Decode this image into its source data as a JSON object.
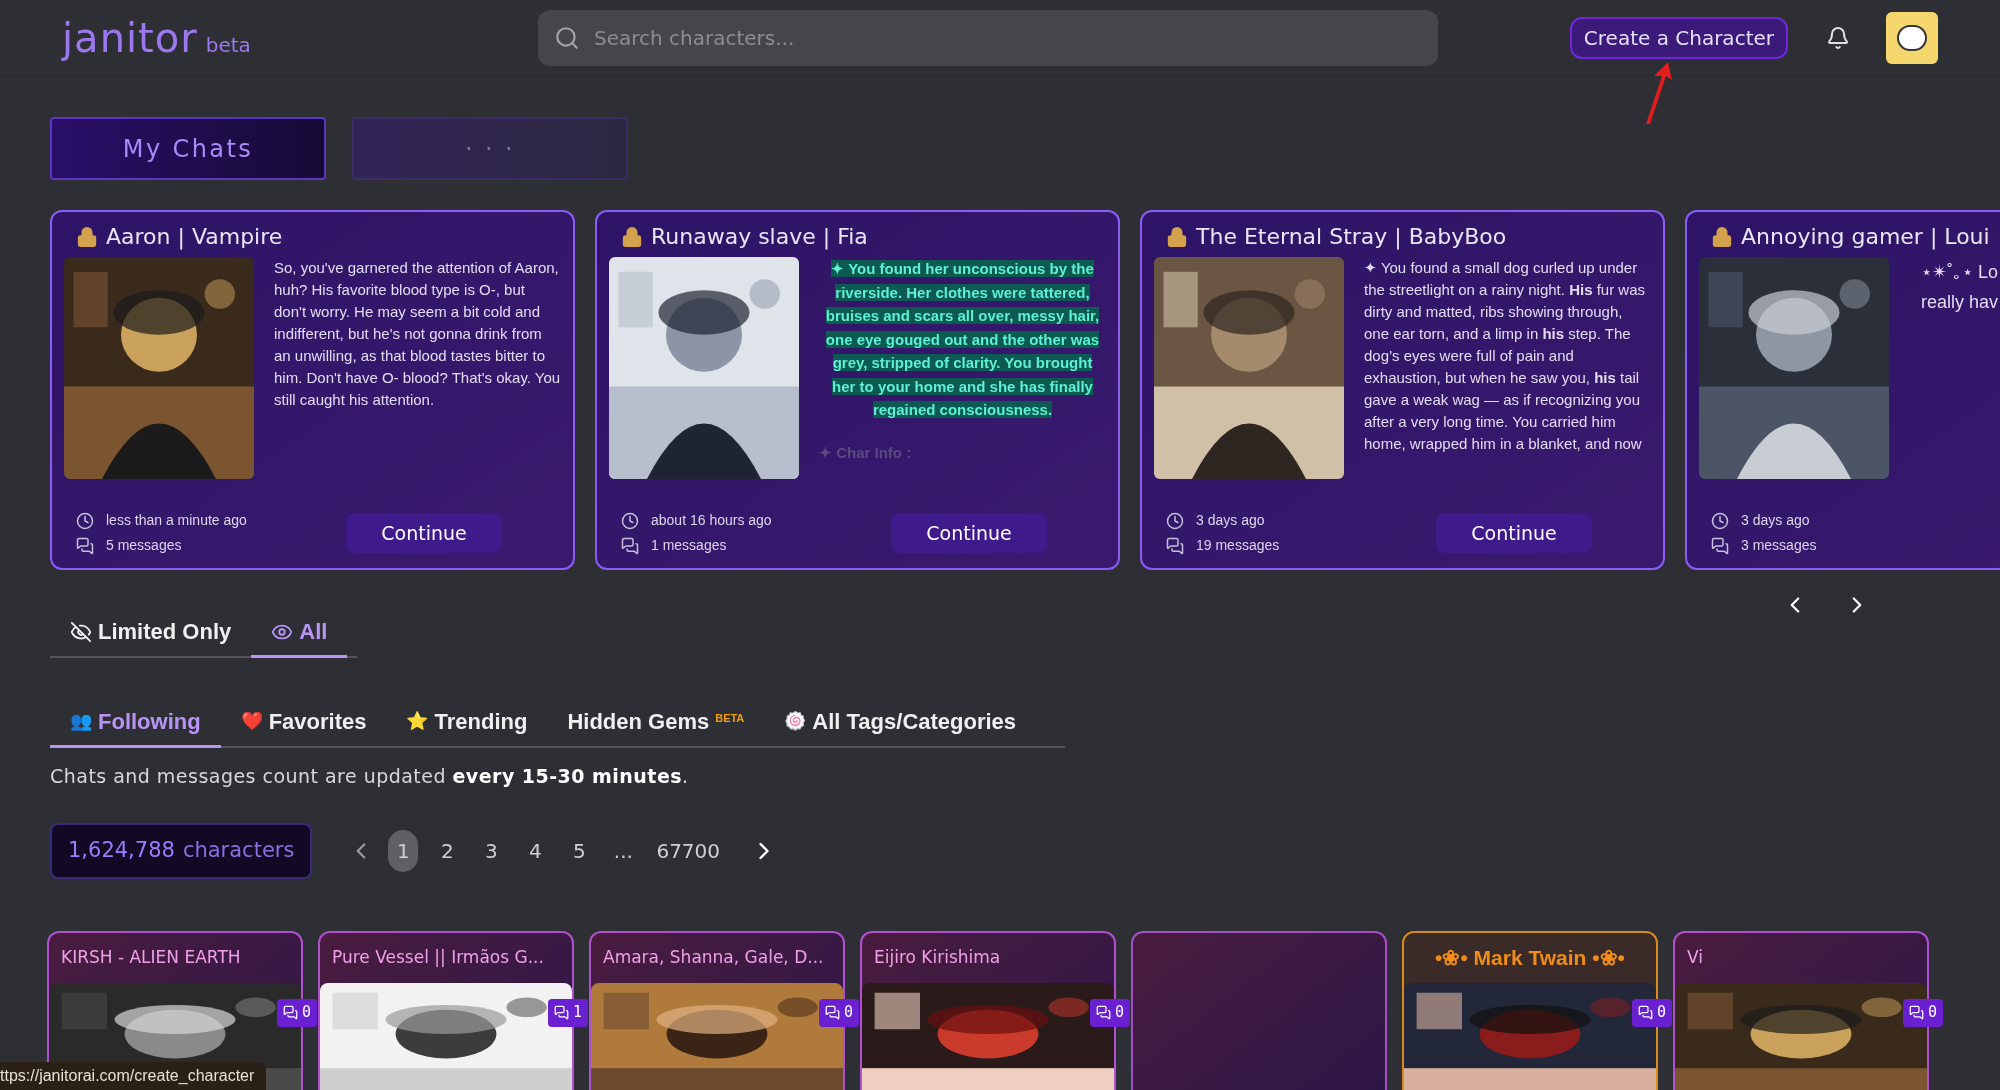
{
  "header": {
    "logo": "janitor",
    "logo_badge": "beta",
    "search": {
      "placeholder": "Search characters..."
    },
    "create_button": "Create a Character"
  },
  "chat_tabs": [
    {
      "label": "My Chats",
      "selected": true
    },
    {
      "label": "· · ·",
      "selected": false
    }
  ],
  "chats": [
    {
      "title": "Aaron | Vampire",
      "kind": "plain",
      "description": "So, you've garnered the attention of Aaron, huh? His favorite blood type is O-, but don't worry. He may seem a bit cold and indifferent, but he's not gonna drink from an unwilling, as that blood tastes bitter to him. Don't have O- blood? That's okay. You still caught his attention.",
      "time": "less than a minute ago",
      "messages": "5 messages",
      "button": "Continue"
    },
    {
      "title": "Runaway slave | Fia",
      "kind": "highlight",
      "description": "✦ You found her unconscious by the riverside. Her clothes were tattered, bruises and scars all over, messy hair, one eye gouged out and the other was grey, stripped of clarity. You brought her to your home and she has finally regained consciousness.",
      "note": "✦ Char Info :",
      "time": "about 16 hours ago",
      "messages": "1 messages",
      "button": "Continue"
    },
    {
      "title": "The Eternal Stray | BabyBoo",
      "kind": "plain",
      "description": "✦ You found a small dog curled up under the streetlight on a rainy night. **His** fur was dirty and matted, ribs showing through, one ear torn, and a limp in **his** step. The dog’s eyes were full of pain and exhaustion, but when he saw you, **his** tail gave a weak wag — as if recognizing you after a very long time. You carried him home, wrapped him in a blanket, and now",
      "time": "3 days ago",
      "messages": "19 messages",
      "button": "Continue"
    },
    {
      "title": "Annoying gamer | Loui",
      "kind": "plain",
      "description": "⋆✴︎˚｡⋆ Lo\nreally hav",
      "time": "3 days ago",
      "messages": "3 messages"
    }
  ],
  "filter_tabs": [
    {
      "label": "Limited Only",
      "kind": "hidden",
      "selected": false
    },
    {
      "label": "All",
      "kind": "visible",
      "selected": true
    }
  ],
  "category_tabs": [
    {
      "label": "Following",
      "emoji": "👥",
      "selected": true
    },
    {
      "label": "Favorites",
      "emoji": "❤️",
      "selected": false
    },
    {
      "label": "Trending",
      "emoji": "⭐",
      "selected": false
    },
    {
      "label": "Hidden Gems",
      "badge": "BETA",
      "selected": false
    },
    {
      "label": "All Tags/Categories",
      "emoji": "🍥",
      "selected": false
    }
  ],
  "notice": "Chats and messages count are updated **every 15-30 minutes**.",
  "count": {
    "number": "1,624,788",
    "label": "characters"
  },
  "pagination": [
    {
      "label": "1",
      "selected": true
    },
    {
      "label": "2",
      "selected": false
    },
    {
      "label": "3",
      "selected": false
    },
    {
      "label": "4",
      "selected": false
    },
    {
      "label": "5",
      "selected": false
    },
    {
      "label": "...",
      "selected": false
    },
    {
      "label": "67700",
      "selected": false
    }
  ],
  "characters": [
    {
      "title": "KIRSH - ALIEN EARTH",
      "kind": "picture",
      "chats": "0"
    },
    {
      "title": "Pure Vessel || Irmãos G...",
      "kind": "picture",
      "chats": "1"
    },
    {
      "title": "Amara, Shanna, Gale, D...",
      "kind": "picture",
      "chats": "0"
    },
    {
      "title": "Eijiro Kirishima",
      "kind": "picture",
      "chats": "0"
    },
    {
      "kind": "empty"
    },
    {
      "title": "•❀• Mark Twain •❀•",
      "kind": "picture",
      "featured": true,
      "chats": "0"
    },
    {
      "title": "Vi",
      "kind": "picture",
      "chats": "0"
    }
  ],
  "status_url": "ttps://janitorai.com/create_character"
}
